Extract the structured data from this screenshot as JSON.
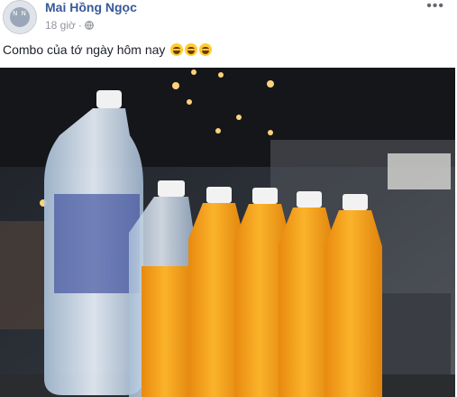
{
  "post": {
    "author": "Mai Hồng Ngọc",
    "time": "18 giờ",
    "privacy_icon": "globe-icon",
    "more_icon": "more-horizontal-icon",
    "caption": "Combo của tớ ngày hôm nay",
    "emojis": [
      "laughing-emoji",
      "laughing-emoji",
      "laughing-emoji"
    ]
  },
  "photo": {
    "subject": "bottles-photo",
    "colors": {
      "juice": "#f7a21b",
      "water": "#cfe0f2",
      "cap": "#f4f4f4",
      "background": "#2b2e35"
    }
  }
}
